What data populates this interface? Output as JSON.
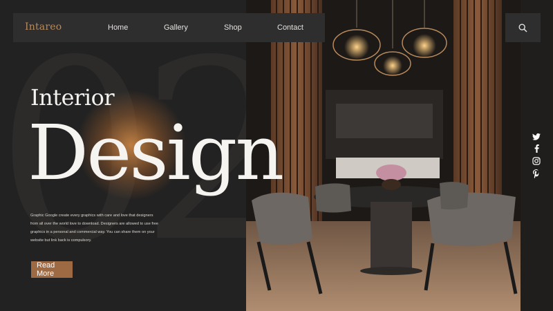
{
  "brand": {
    "logo": "Intareo"
  },
  "nav": {
    "links": [
      "Home",
      "Gallery",
      "Shop",
      "Contact"
    ]
  },
  "hero": {
    "number": "02",
    "title_small": "Interior",
    "title_large": "Design",
    "description": "Graphic Google create every graphics with care and love that designers from all over the world love to download. Designers are allowed to use free graphics in a personal and commercial way. You can share them on your website but link back is compulsory.",
    "cta": "Read More"
  },
  "social": {
    "icons": [
      "twitter-icon",
      "facebook-icon",
      "instagram-icon",
      "pinterest-icon"
    ]
  },
  "colors": {
    "background": "#232222",
    "accent": "#9d6a43",
    "logo": "#b88a5c",
    "nav_bg": "#2f2e2e"
  }
}
